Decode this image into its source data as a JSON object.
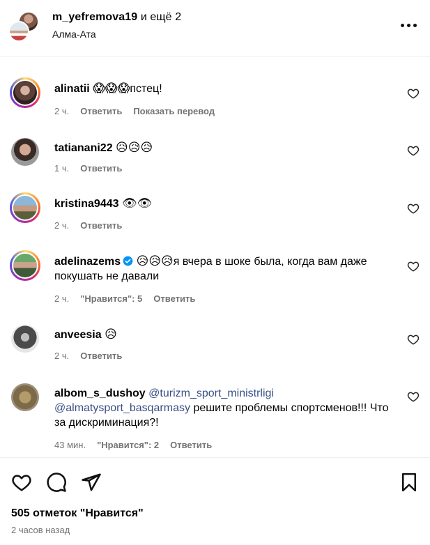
{
  "header": {
    "username": "m_yefremova19",
    "others": "и ещё 2",
    "location": "Алма-Ата"
  },
  "comments": [
    {
      "user": "alinatii",
      "emojis": "😱😱😱",
      "text": "пстец!",
      "time": "2 ч.",
      "reply": "Ответить",
      "translate": "Показать перевод"
    },
    {
      "user": "tatianani22",
      "emojis": "😥😥😥",
      "time": "1 ч.",
      "reply": "Ответить"
    },
    {
      "user": "kristina9443",
      "emojis": "👁👁",
      "time": "2 ч.",
      "reply": "Ответить"
    },
    {
      "user": "adelinazems",
      "emojis": "😥😥😥",
      "text": "я вчера в шоке была, когда вам даже покушать не давали",
      "time": "2 ч.",
      "likes": "\"Нравится\": 5",
      "reply": "Ответить"
    },
    {
      "user": "anveesia",
      "emojis": "😥",
      "time": "2 ч.",
      "reply": "Ответить"
    },
    {
      "user": "albom_s_dushoy",
      "mention1": "@turizm_sport_ministrligi",
      "mention2": "@almatysport_basqarmasy",
      "text": "решите проблемы спортсменов!!! Что за дискриминация?!",
      "time": "43 мин.",
      "likes": "\"Нравится\": 2",
      "reply": "Ответить"
    }
  ],
  "footer": {
    "likes": "505 отметок \"Нравится\"",
    "time": "2 часов назад"
  }
}
